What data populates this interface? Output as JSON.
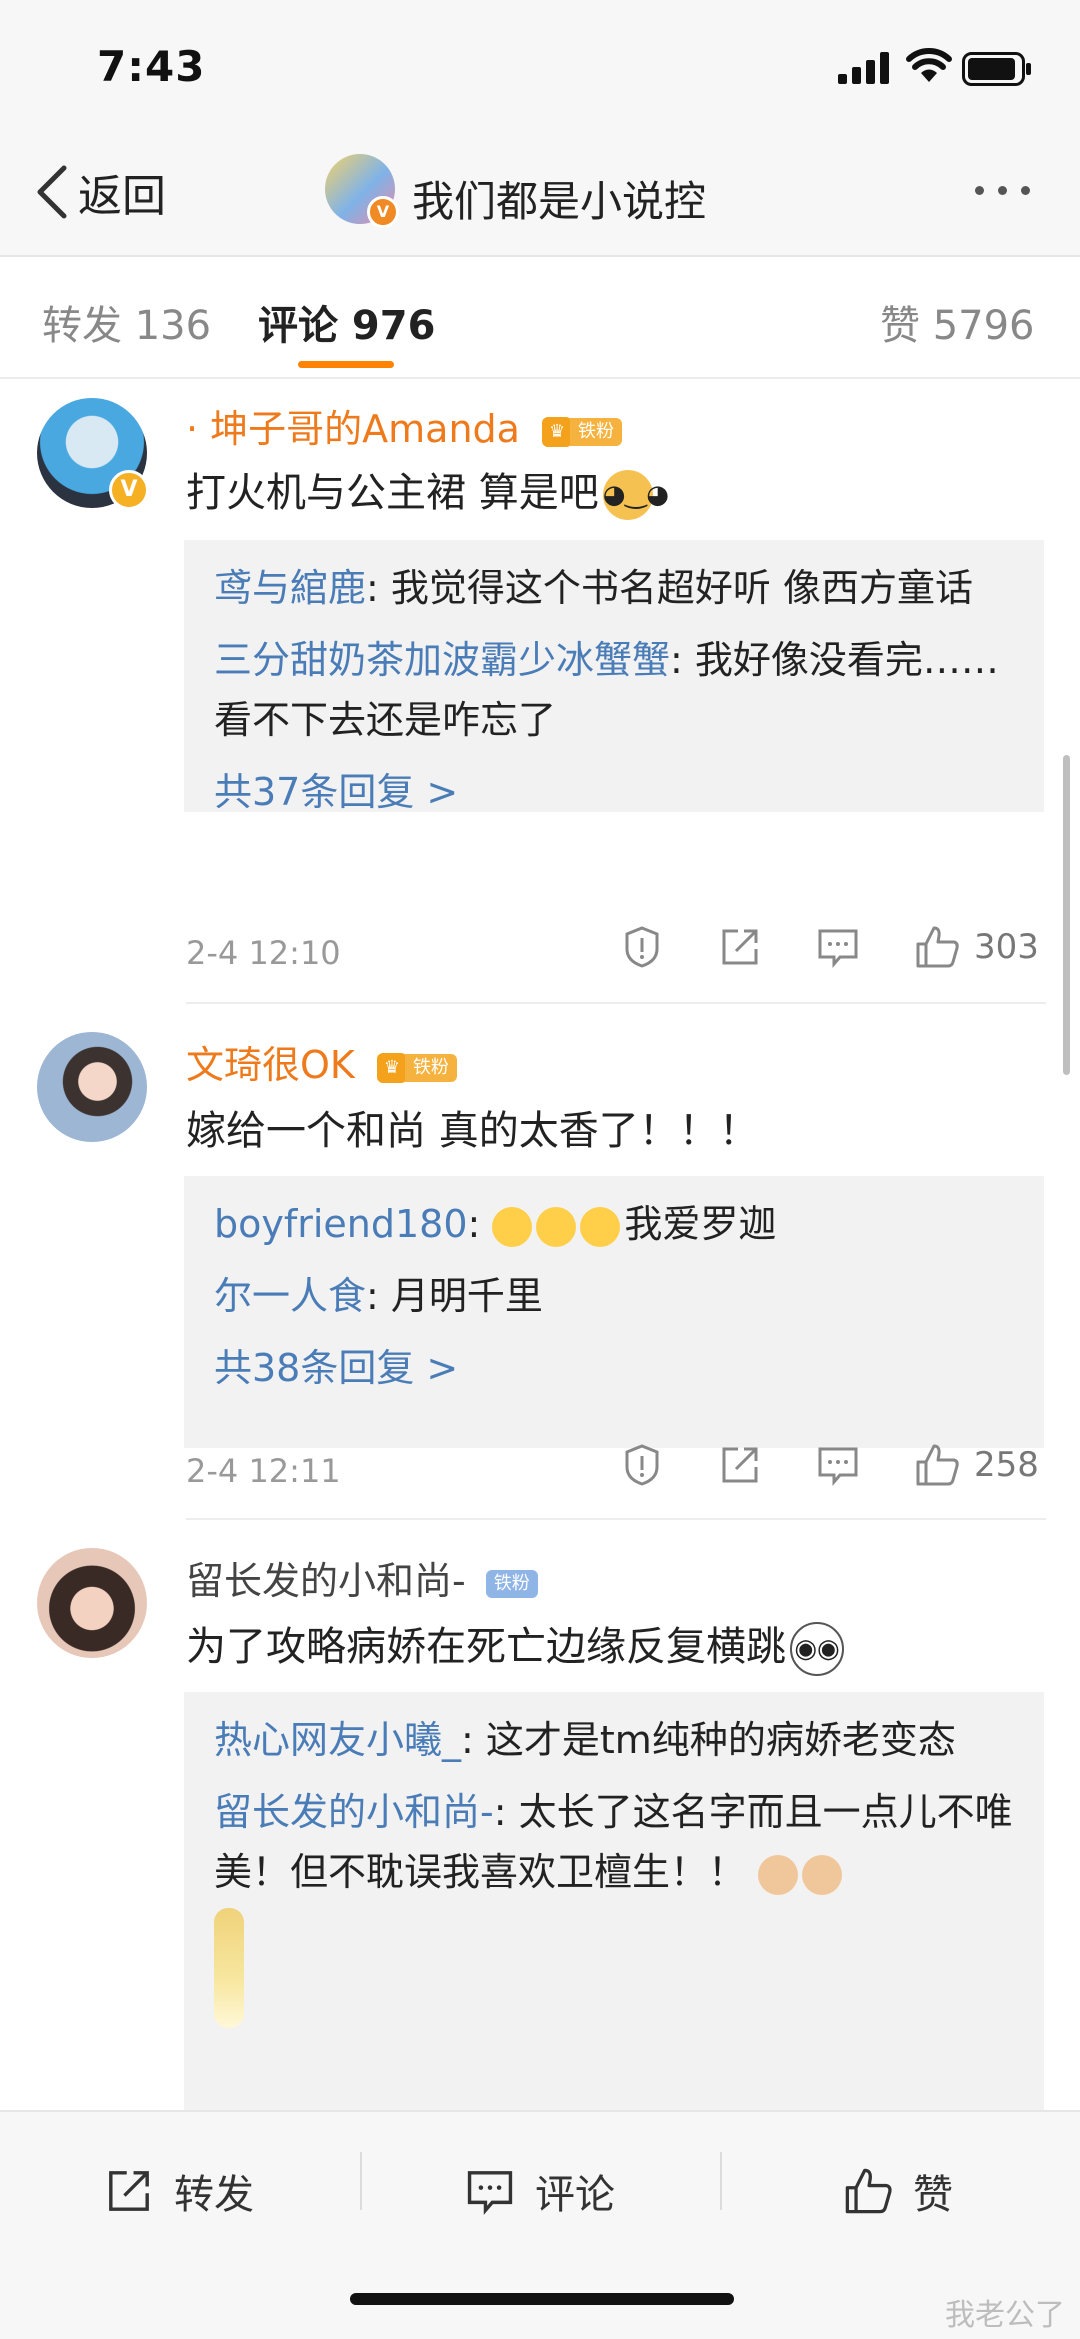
{
  "status": {
    "time": "7:43"
  },
  "nav": {
    "back_label": "返回",
    "title": "我们都是小说控",
    "verified_mark": "V"
  },
  "tabs": [
    {
      "label": "转发 136"
    },
    {
      "label": "评论 976"
    },
    {
      "label": "赞 5796"
    }
  ],
  "comments": [
    {
      "user": "· 坤子哥的Amanda",
      "badge": "铁粉",
      "badge_mark": "V",
      "text": "打火机与公主裙 算是吧",
      "replies": [
        {
          "user": "鸢与綰鹿",
          "text": ": 我觉得这个书名超好听 像西方童话"
        },
        {
          "user": "三分甜奶茶加波霸少冰蟹蟹",
          "text": ": 我好像没看完……看不下去还是咋忘了"
        }
      ],
      "reply_total": "共37条回复 >",
      "time": "2-4 12:10",
      "likes": "303"
    },
    {
      "user": "文琦很OK",
      "badge": "铁粉",
      "text": "嫁给一个和尚 真的太香了！！！",
      "replies": [
        {
          "user": "boyfriend180",
          "text": "我爱罗迦"
        },
        {
          "user": "尔一人食",
          "text": ": 月明千里"
        }
      ],
      "reply_total": "共38条回复 >",
      "time": "2-4 12:11",
      "likes": "258"
    },
    {
      "user": "留长发的小和尚-",
      "badge": "铁粉",
      "text": "为了攻略病娇在死亡边缘反复横跳",
      "replies": [
        {
          "user": "热心网友小曦_",
          "text": ": 这才是tm纯种的病娇老变态"
        },
        {
          "user": "留长发的小和尚-",
          "text": ": 太长了这名字而且一点儿不唯美！但不耽误我喜欢卫檀生！！"
        }
      ]
    }
  ],
  "bottom": {
    "repost": "转发",
    "comment": "评论",
    "like": "赞"
  },
  "watermark": "我老公了"
}
